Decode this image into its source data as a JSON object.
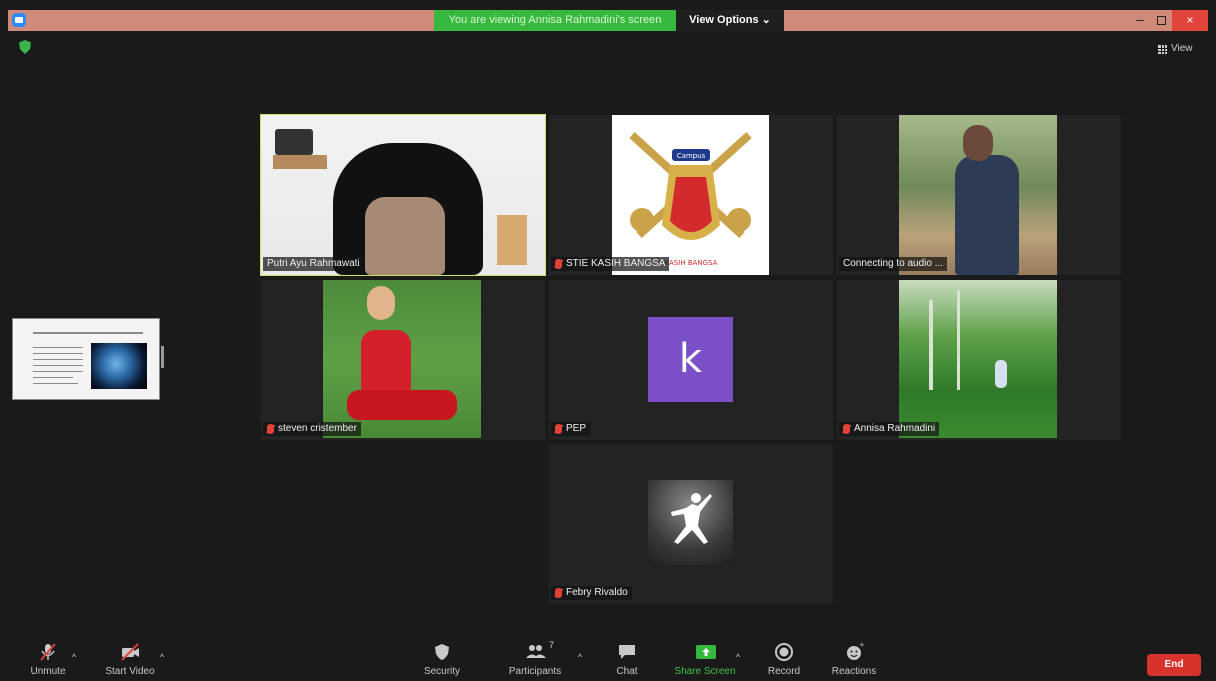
{
  "titlebar": {
    "banner": "You are viewing Annisa Rahmadini's screen",
    "view_options": "View Options ⌄",
    "minimize": "–",
    "close": "×"
  },
  "top": {
    "view_label": "View"
  },
  "participants": [
    {
      "name": "Putri Ayu Rahmawati",
      "muted": false,
      "active": true
    },
    {
      "name": "STIE KASIH BANGSA",
      "muted": true,
      "logo_text": "Campus",
      "logo_band": "KASIH BANGSA"
    },
    {
      "name": "Connecting to audio ...",
      "muted": false
    },
    {
      "name": "steven cristember",
      "muted": true
    },
    {
      "name": "PEP",
      "muted": true,
      "avatar_letter": "k",
      "avatar_color": "#7a4fc7"
    },
    {
      "name": "Annisa Rahmadini",
      "muted": true
    },
    {
      "name": "Febry Rivaldo",
      "muted": true
    }
  ],
  "toolbar": {
    "unmute": "Unmute",
    "start_video": "Start Video",
    "security": "Security",
    "participants": "Participants",
    "participants_count": "7",
    "chat": "Chat",
    "share_screen": "Share Screen",
    "record": "Record",
    "reactions": "Reactions",
    "end": "End"
  },
  "colors": {
    "share_green": "#36b93e",
    "end_red": "#d7332c",
    "active_border": "#c9e36a",
    "mute_red": "#e0423a"
  }
}
